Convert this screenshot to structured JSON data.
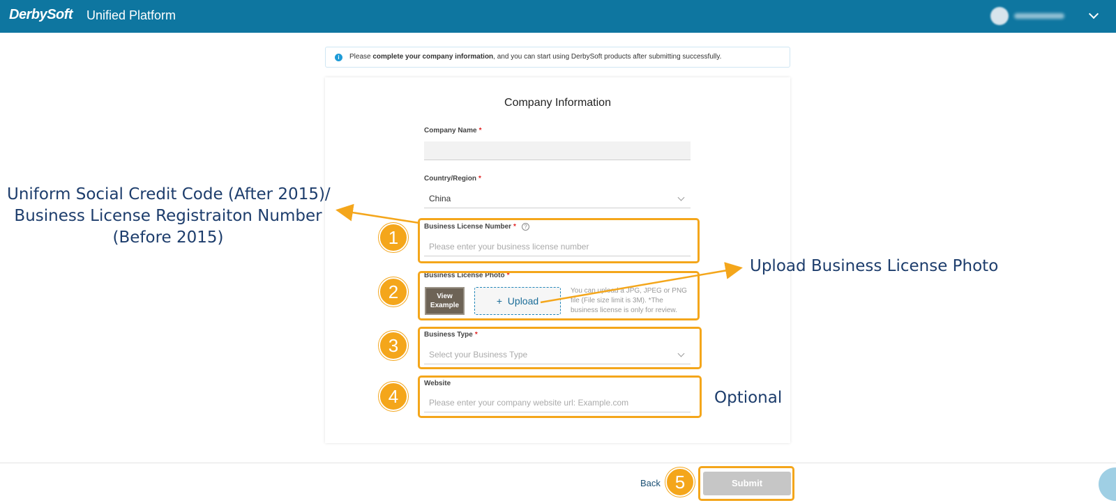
{
  "header": {
    "logo": "DerbySoft",
    "platform": "Unified Platform"
  },
  "notice": {
    "prefix": "Please ",
    "bold": "complete your company information",
    "suffix": ", and you can start using DerbySoft products after submitting successfully."
  },
  "form": {
    "title": "Company Information",
    "company_name": {
      "label": "Company Name",
      "required": "*"
    },
    "country": {
      "label": "Country/Region",
      "required": "*",
      "value": "China"
    },
    "license_number": {
      "label": "Business License Number",
      "required": "*",
      "placeholder": "Please enter your business license number"
    },
    "license_photo": {
      "label": "Business License Photo",
      "required": "*",
      "example_label": "View Example",
      "upload_label": "Upload",
      "upload_icon": "+",
      "hint": "You can upload a JPG, JPEG or PNG file (File size limit is 3M). *The business license is only for review."
    },
    "business_type": {
      "label": "Business Type",
      "required": "*",
      "placeholder": "Select your Business Type"
    },
    "website": {
      "label": "Website",
      "placeholder": "Please enter your company website url: Example.com"
    }
  },
  "footer": {
    "back_label": "Back",
    "submit_label": "Submit"
  },
  "annotations": {
    "license_code_line1": "Uniform Social Credit Code (After 2015)/",
    "license_code_line2": "Business License Registraiton Number",
    "license_code_line3": "(Before 2015)",
    "upload_photo": "Upload Business License Photo",
    "optional": "Optional",
    "badges": [
      "1",
      "2",
      "3",
      "4",
      "5"
    ]
  },
  "colors": {
    "header_bg": "#0e76a0",
    "highlight": "#f4a61b",
    "annotation_text": "#1d3d6c",
    "required": "#e02020"
  }
}
